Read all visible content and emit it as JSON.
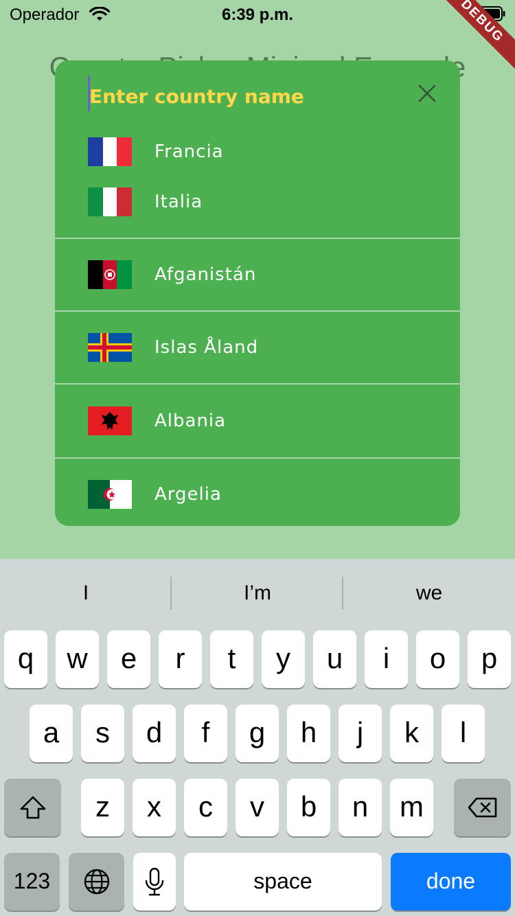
{
  "status_bar": {
    "carrier": "Operador",
    "time": "6:39 p.m."
  },
  "debug_banner": "DEBUG",
  "page": {
    "title": "Country Picker Minimal Example"
  },
  "dialog": {
    "search_placeholder": "Enter country name",
    "favorites": [
      {
        "name": "Francia",
        "flag": "flag-france"
      },
      {
        "name": "Italia",
        "flag": "flag-italy"
      }
    ],
    "countries": [
      {
        "name": "Afganistán",
        "flag": "flag-afghanistan"
      },
      {
        "name": "Islas Åland",
        "flag": "flag-aland"
      },
      {
        "name": "Albania",
        "flag": "flag-albania"
      },
      {
        "name": "Argelia",
        "flag": "flag-algeria"
      }
    ]
  },
  "keyboard": {
    "suggestions": [
      "I",
      "I’m",
      "we"
    ],
    "row1": [
      "q",
      "w",
      "e",
      "r",
      "t",
      "y",
      "u",
      "i",
      "o",
      "p"
    ],
    "row2": [
      "a",
      "s",
      "d",
      "f",
      "g",
      "h",
      "j",
      "k",
      "l"
    ],
    "row3": [
      "z",
      "x",
      "c",
      "v",
      "b",
      "n",
      "m"
    ],
    "numbers_label": "123",
    "space_label": "space",
    "done_label": "done"
  },
  "colors": {
    "background": "#a5d5a6",
    "dialog": "#4caf50",
    "placeholder": "#ffd84a",
    "done_key": "#0a7bff"
  }
}
